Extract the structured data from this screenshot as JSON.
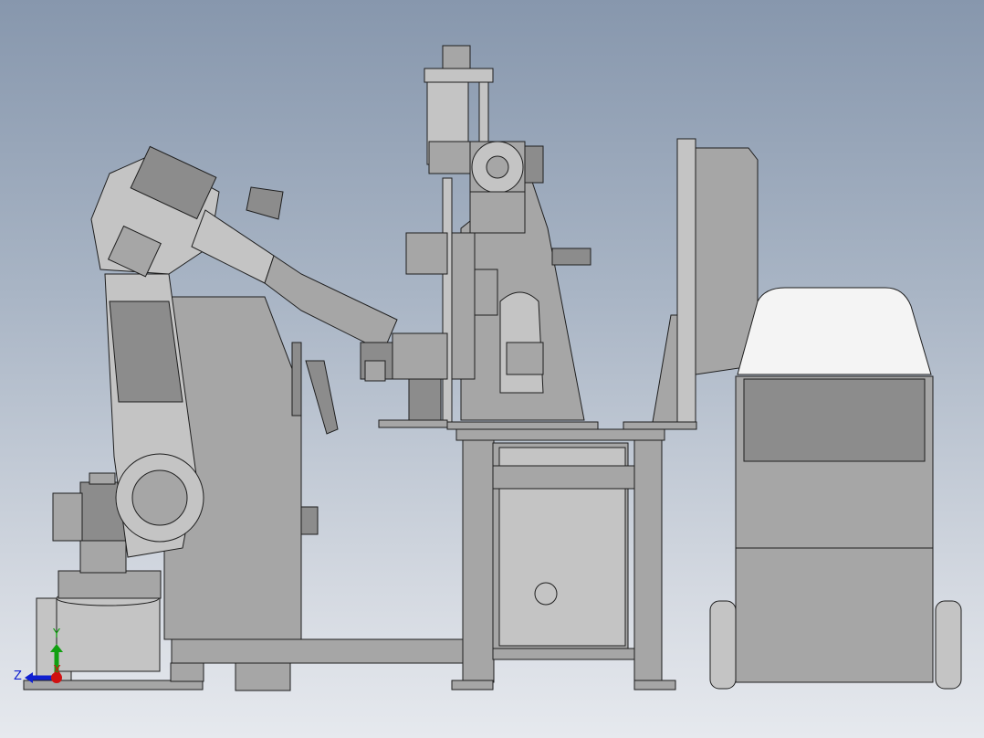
{
  "viewport": {
    "triad": {
      "x_label": "X",
      "y_label": "Y",
      "z_label": "Z",
      "colors": {
        "x": "#d01010",
        "y": "#10a010",
        "z": "#1020d0"
      }
    }
  }
}
